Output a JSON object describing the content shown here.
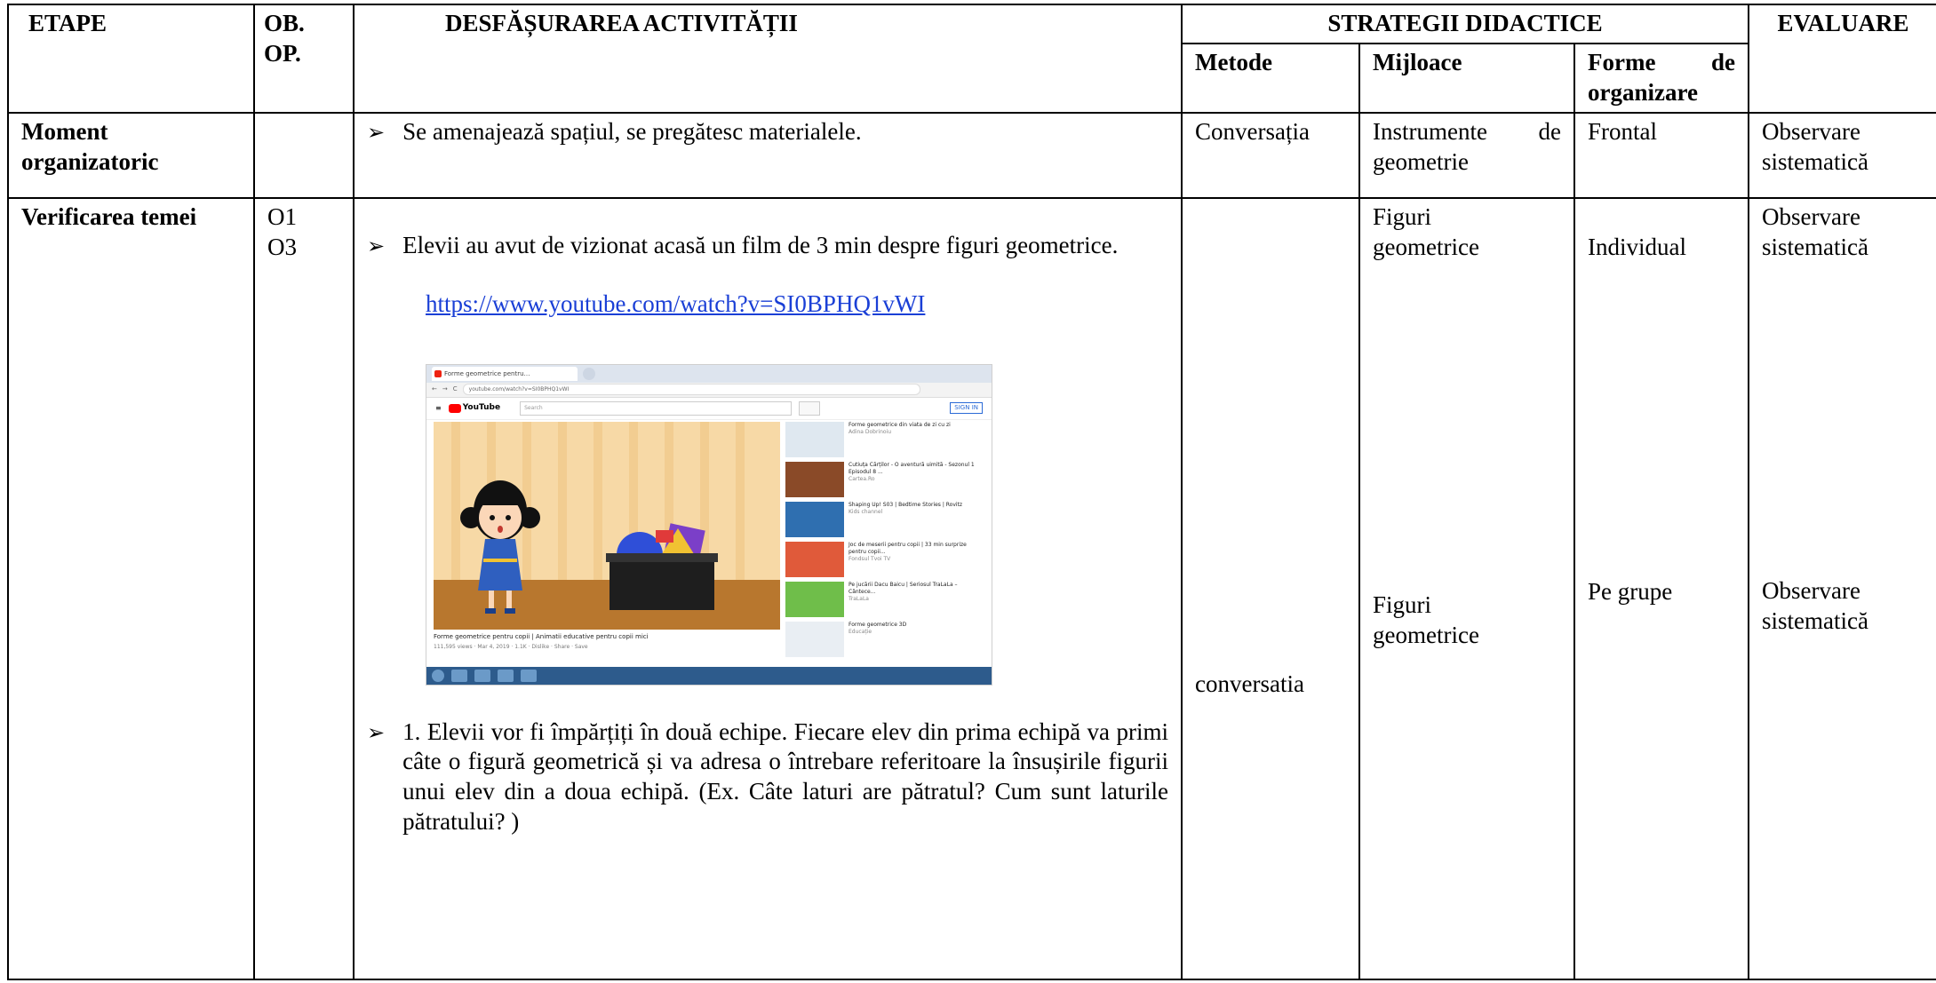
{
  "headers": {
    "etape": "ETAPE",
    "ob_op_line1": "OB.",
    "ob_op_line2": "OP.",
    "desfasurare": "DESFĂȘURAREA ACTIVITĂȚII",
    "strategii": "STRATEGII DIDACTICE",
    "evaluare": "EVALUARE",
    "metode": "Metode",
    "mijloace": "Mijloace",
    "forme_line1_a": "Forme",
    "forme_line1_b": "de",
    "forme_line2": "organizare"
  },
  "rows": [
    {
      "etapa_line1": "Moment",
      "etapa_line2": "organizatoric",
      "activitate": "Se amenajează spațiul, se pregătesc materialele.",
      "metode": "Conversația",
      "mijloace_a": "Instrumente",
      "mijloace_b": "de",
      "mijloace_line2": "geometrie",
      "forme": "Frontal",
      "evaluare_line1": "Observare",
      "evaluare_line2": "sistematică"
    },
    {
      "etapa": "Verificarea temei",
      "ob1": "O1",
      "ob2": "O3",
      "activitate1": "Elevii au avut de vizionat acasă un film de 3 min despre figuri geometrice.",
      "link": "https://www.youtube.com/watch?v=SI0BPHQ1vWI",
      "activitate2": "1. Elevii vor fi împărțiți în două echipe. Fiecare elev din prima echipă va primi câte o figură geometrică și va adresa o întrebare referitoare la însușirile figurii unui elev din a doua echipă. (Ex. Câte laturi are pătratul? Cum sunt laturile pătratului? )",
      "metode": "conversatia",
      "mijloace1_line1": "Figuri",
      "mijloace1_line2": "geometrice",
      "mijloace2_line1": "Figuri",
      "mijloace2_line2": "geometrice",
      "forme1": "Individual",
      "forme2": "Pe grupe",
      "evaluare1_line1": "Observare",
      "evaluare1_line2": "sistematică",
      "evaluare2_line1": "Observare",
      "evaluare2_line2": "sistematică"
    }
  ],
  "screenshot": {
    "tab_title": "Forme geometrice pentru…",
    "address": "youtube.com/watch?v=SI0BPHQ1vWI",
    "youtube_label": "YouTube",
    "search_placeholder": "Search",
    "sign_in": "SIGN IN",
    "video_title": "Forme geometrice pentru copii | Animatii educative pentru copii mici",
    "video_meta": "111,595 views · Mar 4, 2019 · 1.1K · Dislike · Share · Save",
    "recommendations": [
      {
        "title": "Forme geometrice din viata de zi cu zi",
        "sub": "Adina Dobrinoiu",
        "color": "#dfe8f0"
      },
      {
        "title": "Cutiuța Cărților - O aventură uimită - Sezonul 1 Episodul 8 ...",
        "sub": "Cartea.Ro",
        "color": "#8a4a28"
      },
      {
        "title": "Shaping Up! S03 | Bedtime Stories | Rovitz",
        "sub": "Kids channel",
        "color": "#2f6fb0"
      },
      {
        "title": "Joc de meserii pentru copii | 33 min surprize pentru copii...",
        "sub": "Fondsul Tvoi TV",
        "color": "#e05a3a"
      },
      {
        "title": "Pe jucării Dacu Baicu | Seriosul TraLaLa – Cântece...",
        "sub": "TraLaLa",
        "color": "#6fbe4a"
      },
      {
        "title": "Forme geometrice 3D",
        "sub": "Educație",
        "color": "#e9eef3"
      }
    ]
  }
}
